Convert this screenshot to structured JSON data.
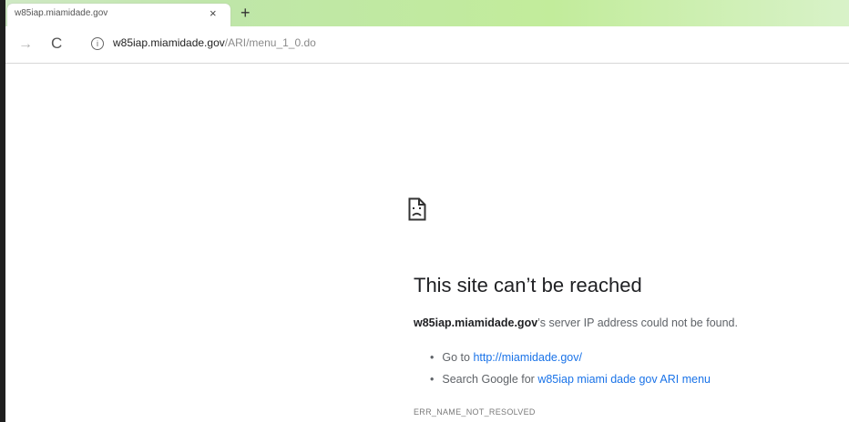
{
  "tab": {
    "title": "w85iap.miamidade.gov",
    "close_glyph": "×",
    "new_tab_glyph": "+"
  },
  "toolbar": {
    "forward_glyph": "→",
    "reload_glyph": "C",
    "url_host": "w85iap.miamidade.gov",
    "url_path": "/ARI/menu_1_0.do"
  },
  "error": {
    "icon": "sad-page-icon",
    "headline": "This site can’t be reached",
    "host": "w85iap.miamidade.gov",
    "detail_suffix": "’s server IP address could not be found.",
    "suggestions": [
      {
        "prefix": "Go to ",
        "link": "http://miamidade.gov/"
      },
      {
        "prefix": "Search Google for ",
        "link": "w85iap miami dade gov ARI menu"
      }
    ],
    "code": "ERR_NAME_NOT_RESOLVED"
  },
  "colors": {
    "tabstrip": "#c2ec9b",
    "link": "#1a73e8",
    "text": "#202124"
  }
}
